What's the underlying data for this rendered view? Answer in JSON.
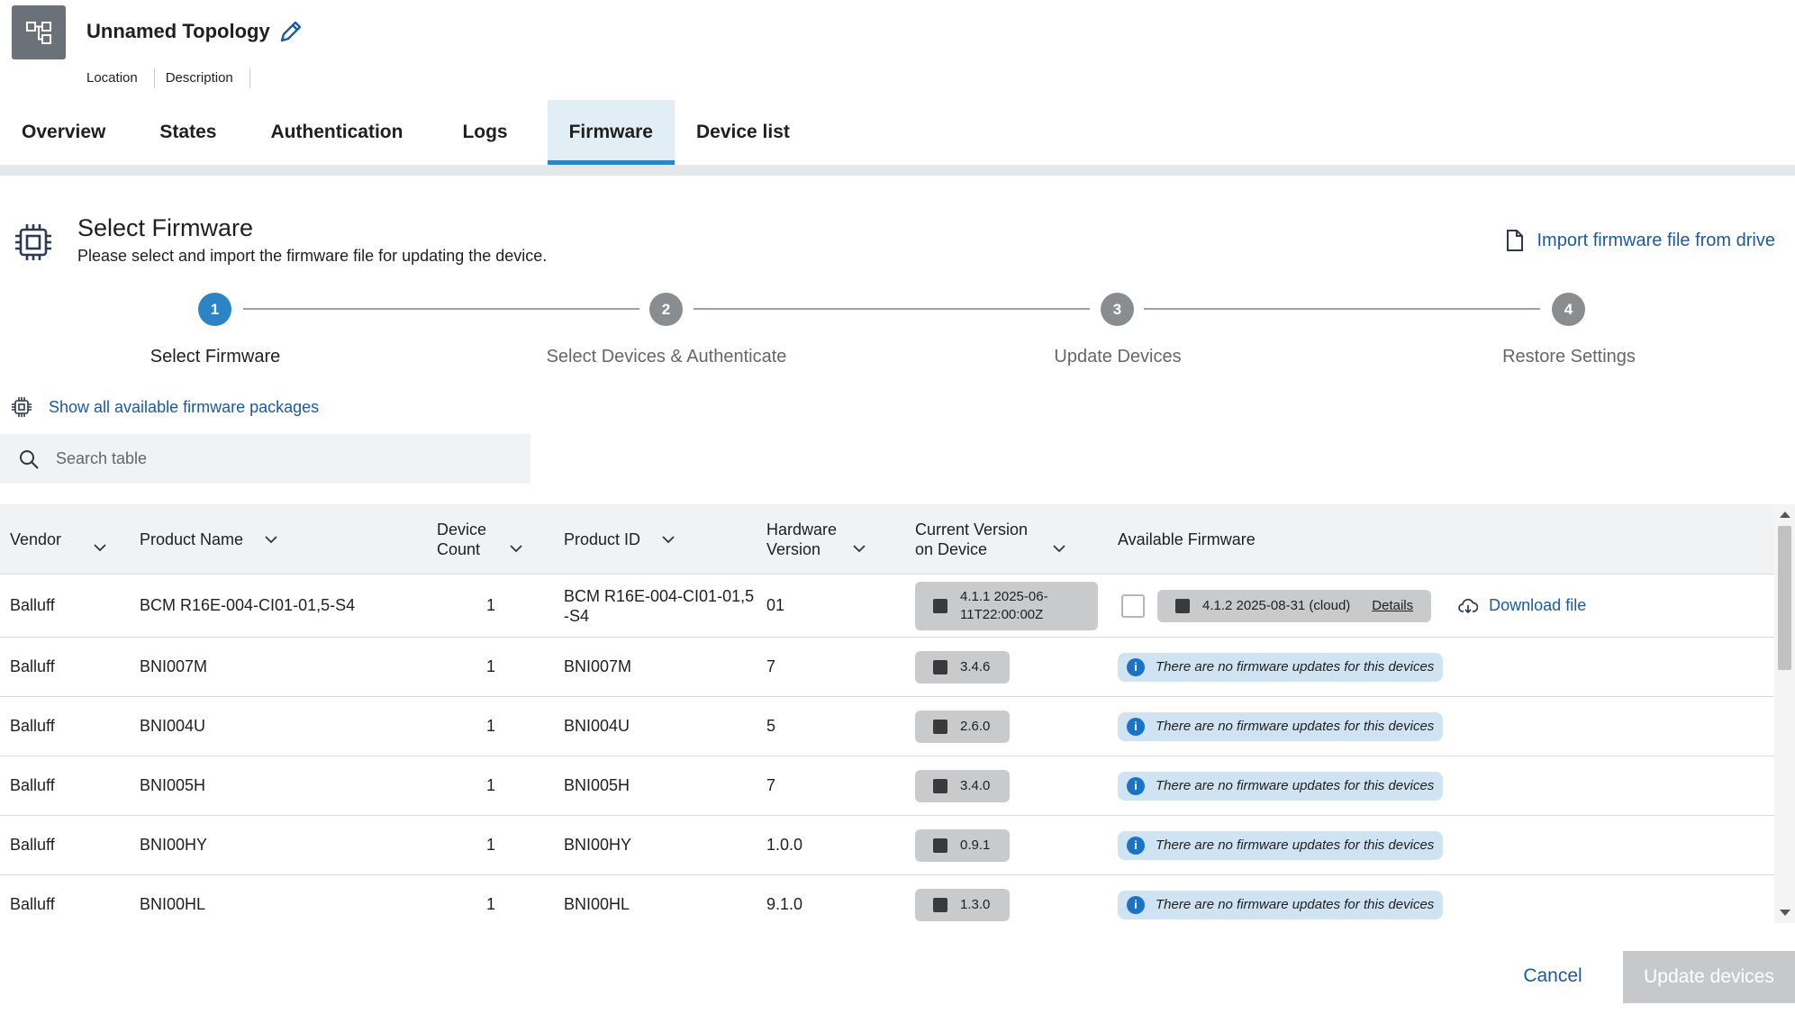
{
  "header": {
    "title": "Unnamed Topology",
    "meta": [
      "Location",
      "Description"
    ]
  },
  "tabs": [
    {
      "label": "Overview",
      "active": false
    },
    {
      "label": "States",
      "active": false
    },
    {
      "label": "Authentication",
      "active": false
    },
    {
      "label": "Logs",
      "active": false
    },
    {
      "label": "Firmware",
      "active": true
    },
    {
      "label": "Device list",
      "active": false
    }
  ],
  "section": {
    "title": "Select Firmware",
    "subtitle": "Please select and import the firmware file for updating the device.",
    "import_label": "Import firmware file from drive"
  },
  "stepper": {
    "steps": [
      {
        "number": "1",
        "label": "Select Firmware",
        "active": true
      },
      {
        "number": "2",
        "label": "Select Devices & Authenticate",
        "active": false
      },
      {
        "number": "3",
        "label": "Update Devices",
        "active": false
      },
      {
        "number": "4",
        "label": "Restore Settings",
        "active": false
      }
    ]
  },
  "firmware": {
    "show_all_label": "Show all available firmware packages",
    "search_placeholder": "Search table"
  },
  "table": {
    "columns": {
      "vendor": "Vendor",
      "product_name": "Product Name",
      "device_count_1": "Device",
      "device_count_2": "Count",
      "product_id": "Product ID",
      "hw_1": "Hardware",
      "hw_2": "Version",
      "cur_1": "Current Version",
      "cur_2": "on Device",
      "available": "Available Firmware"
    },
    "no_updates_text": "There are no firmware updates for this devices",
    "details_label": "Details",
    "download_label": "Download file",
    "rows": [
      {
        "vendor": "Balluff",
        "product_name": "BCM R16E-004-CI01-01,5-S4",
        "count": "1",
        "product_id_1": "BCM R16E-004-CI01-01,5",
        "product_id_2": "-S4",
        "hw": "01",
        "cur_1": "4.1.1 2025-06-",
        "cur_2": "11T22:00:00Z",
        "available": "4.1.2 2025-08-31 (cloud)"
      },
      {
        "vendor": "Balluff",
        "product_name": "BNI007M",
        "count": "1",
        "product_id": "BNI007M",
        "hw": "7",
        "cur": "3.4.6"
      },
      {
        "vendor": "Balluff",
        "product_name": "BNI004U",
        "count": "1",
        "product_id": "BNI004U",
        "hw": "5",
        "cur": "2.6.0"
      },
      {
        "vendor": "Balluff",
        "product_name": "BNI005H",
        "count": "1",
        "product_id": "BNI005H",
        "hw": "7",
        "cur": "3.4.0"
      },
      {
        "vendor": "Balluff",
        "product_name": "BNI00HY",
        "count": "1",
        "product_id": "BNI00HY",
        "hw": "1.0.0",
        "cur": "0.9.1"
      },
      {
        "vendor": "Balluff",
        "product_name": "BNI00HL",
        "count": "1",
        "product_id": "BNI00HL",
        "hw": "9.1.0",
        "cur": "1.3.0"
      }
    ]
  },
  "footer": {
    "cancel_label": "Cancel",
    "update_label": "Update devices"
  },
  "colors": {
    "accent": "#2b84c6",
    "link": "#1b5aa0",
    "step_inactive": "#8a8d90"
  }
}
